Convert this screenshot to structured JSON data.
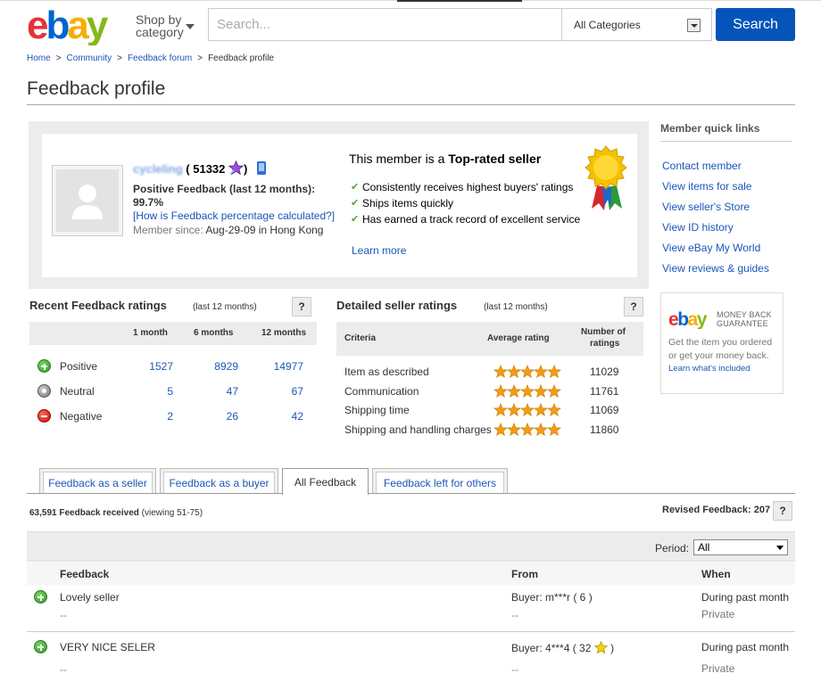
{
  "header": {
    "shop_by_line1": "Shop by",
    "shop_by_line2": "category",
    "search_placeholder": "Search...",
    "category_selected": "All Categories",
    "search_button": "Search"
  },
  "breadcrumb": {
    "home": "Home",
    "community": "Community",
    "forum": "Feedback forum",
    "current": "Feedback profile",
    "separator": ">"
  },
  "page_title": "Feedback profile",
  "profile": {
    "username": "cycleling",
    "score_open": "(",
    "score": "51332",
    "score_close": ")",
    "positive_label": "Positive Feedback (last 12 months):",
    "positive_pct": "99.7%",
    "how_calc": "[How is Feedback percentage calculated?]",
    "member_since_label": "Member since:",
    "member_since_value": "Aug-29-09 in Hong Kong",
    "toprated_prefix": "This member is a",
    "toprated_bold": "Top-rated seller",
    "checks": [
      "Consistently receives highest buyers' ratings",
      "Ships items quickly",
      "Has earned a track record of excellent service"
    ],
    "learn_more": "Learn more"
  },
  "quick_links": {
    "title": "Member quick links",
    "items": [
      "Contact member",
      "View items for sale",
      "View seller's Store",
      "View ID history",
      "View eBay My World",
      "View reviews & guides"
    ]
  },
  "mbg": {
    "tag_line1": "MONEY BACK",
    "tag_line2": "GUARANTEE",
    "text": "Get the item you ordered or get your money back.",
    "link": "Learn what's included"
  },
  "recent": {
    "title": "Recent Feedback ratings",
    "subtitle": "(last 12 months)",
    "help": "?",
    "columns": [
      "1 month",
      "6 months",
      "12 months"
    ],
    "rows": [
      {
        "label": "Positive",
        "values": [
          "1527",
          "8929",
          "14977"
        ]
      },
      {
        "label": "Neutral",
        "values": [
          "5",
          "47",
          "67"
        ]
      },
      {
        "label": "Negative",
        "values": [
          "2",
          "26",
          "42"
        ]
      }
    ]
  },
  "dsr": {
    "title": "Detailed seller ratings",
    "subtitle": "(last 12 months)",
    "help": "?",
    "col_criteria": "Criteria",
    "col_avg": "Average rating",
    "col_count_1": "Number of",
    "col_count_2": "ratings",
    "rows": [
      {
        "criteria": "Item as described",
        "stars": 5,
        "count": "11029"
      },
      {
        "criteria": "Communication",
        "stars": 5,
        "count": "11761"
      },
      {
        "criteria": "Shipping time",
        "stars": 5,
        "count": "11069"
      },
      {
        "criteria": "Shipping and handling charges",
        "stars": 5,
        "count": "11860"
      }
    ]
  },
  "tabs": [
    {
      "label": "Feedback as a seller",
      "active": false
    },
    {
      "label": "Feedback as a buyer",
      "active": false
    },
    {
      "label": "All Feedback",
      "active": true
    },
    {
      "label": "Feedback left for others",
      "active": false
    }
  ],
  "feedback": {
    "received_bold": "63,591 Feedback received",
    "received_viewing": "(viewing 51-75)",
    "revised": "Revised Feedback: 207",
    "help": "?",
    "period_label": "Period:",
    "period_value": "All",
    "col_feedback": "Feedback",
    "col_from": "From",
    "col_when": "When",
    "rows": [
      {
        "type": "positive",
        "comment": "Lovely seller",
        "from": "Buyer: m***r ( 6 )",
        "when": "During past month",
        "dash": "--",
        "private": "Private"
      },
      {
        "type": "positive",
        "comment": "VERY NICE SELER",
        "from_prefix": "Buyer: 4***4 ( 32",
        "from_suffix": ")",
        "when": "During past month",
        "dash": "--",
        "private": "Private"
      }
    ]
  },
  "colors": {
    "link": "#1a56b8",
    "search_button": "#0654ba",
    "panel_gray": "#ececec",
    "check_green": "#52a52e",
    "star_orange": "#f39c12"
  }
}
